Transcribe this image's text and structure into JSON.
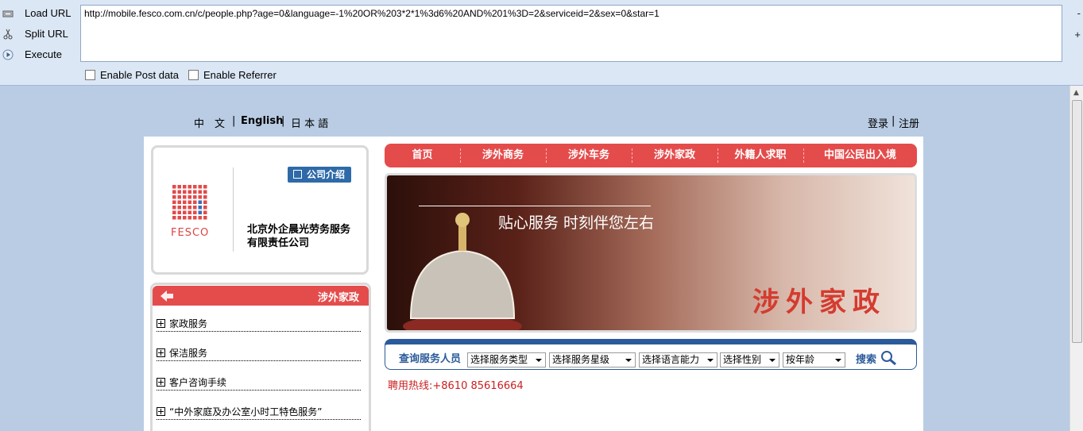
{
  "toolbar": {
    "load_url": "Load URL",
    "split_url": "Split URL",
    "execute": "Execute",
    "url": "http://mobile.fesco.com.cn/c/people.php?age=0&language=-1%20OR%203*2*1%3d6%20AND%201%3D=2&serviceid=2&sex=0&star=1",
    "enable_post": "Enable Post data",
    "enable_referrer": "Enable Referrer",
    "side_minus": "-",
    "side_plus": "+"
  },
  "page": {
    "langs": {
      "zh": "中　文",
      "en": "English",
      "ja": "日 本 語",
      "sep": "|"
    },
    "auth": {
      "login": "登录",
      "sep": "|",
      "register": "注册"
    },
    "company_intro": "公司介绍",
    "company_name": "北京外企晨光劳务服务有限责任公司",
    "logo_text": "FESCO",
    "nav": [
      "首页",
      "涉外商务",
      "涉外车务",
      "涉外家政",
      "外籍人求职",
      "中国公民出入境"
    ],
    "banner": {
      "slogan": "贴心服务  时刻伴您左右",
      "title": "涉外家政"
    },
    "search": {
      "label": "查询服务人员",
      "selects": [
        "选择服务类型",
        "选择服务星级",
        "选择语言能力",
        "选择性别",
        "按年龄"
      ],
      "button": "搜索"
    },
    "hotline": "聘用热线:+8610 85616664",
    "sidebar": {
      "title": "涉外家政",
      "items": [
        "家政服务",
        "保洁服务",
        "客户咨询手续",
        "“中外家庭及办公室小时工特色服务”"
      ]
    }
  },
  "colors": {
    "accent_red": "#e44c4c",
    "accent_blue": "#2a5a9a",
    "hotline": "#cc1f1f"
  }
}
